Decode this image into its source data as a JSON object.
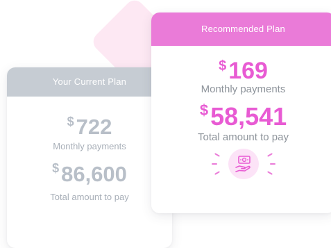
{
  "colors": {
    "current_header_bg": "#c6ccd3",
    "current_text": "#b8bfc8",
    "recommended_header_bg": "#ea7bd8",
    "recommended_price": "#e85bd3",
    "recommended_label": "#8e949b",
    "decor_diamond": "#fde8f3",
    "icon_circle_bg": "#fce3f7"
  },
  "current_plan": {
    "title": "Your Current Plan",
    "currency": "$",
    "monthly_amount": "722",
    "monthly_label": "Monthly payments",
    "total_amount": "86,600",
    "total_label": "Total amount to pay"
  },
  "recommended_plan": {
    "title": "Recommended Plan",
    "currency": "$",
    "monthly_amount": "169",
    "monthly_label": "Monthly payments",
    "total_amount": "58,541",
    "total_label": "Total amount to pay",
    "icon": "hand-money-icon"
  }
}
